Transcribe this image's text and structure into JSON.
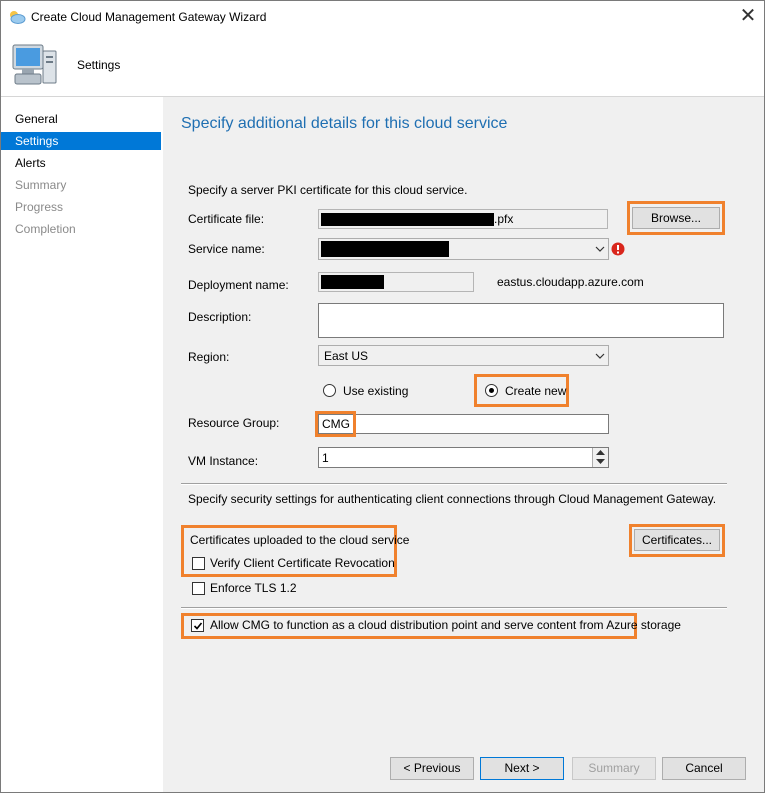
{
  "window": {
    "title": "Create Cloud Management Gateway Wizard",
    "close_glyph": "✕"
  },
  "header": {
    "title": "Settings"
  },
  "nav": [
    {
      "label": "General",
      "state": "normal"
    },
    {
      "label": "Settings",
      "state": "selected"
    },
    {
      "label": "Alerts",
      "state": "normal"
    },
    {
      "label": "Summary",
      "state": "disabled"
    },
    {
      "label": "Progress",
      "state": "disabled"
    },
    {
      "label": "Completion",
      "state": "disabled"
    }
  ],
  "page": {
    "heading": "Specify additional details for this cloud service",
    "pki_intro": "Specify a server PKI certificate for this cloud service.",
    "certificate_file": {
      "label": "Certificate file:",
      "value_suffix": ".pfx",
      "browse_label": "Browse..."
    },
    "service_name": {
      "label": "Service name:"
    },
    "deployment_name": {
      "label": "Deployment name:",
      "domain_suffix": "eastus.cloudapp.azure.com"
    },
    "description": {
      "label": "Description:",
      "value": ""
    },
    "region": {
      "label": "Region:",
      "value": "East US"
    },
    "resource_group_mode": {
      "use_existing": "Use existing",
      "create_new": "Create new",
      "selected": "create_new"
    },
    "resource_group": {
      "label": "Resource Group:",
      "value": "CMG"
    },
    "vm_instance": {
      "label": "VM Instance:",
      "value": "1"
    },
    "security_intro": "Specify security settings for authenticating client connections through Cloud Management Gateway.",
    "certs_uploaded": "Certificates uploaded to the cloud service",
    "certificates_button": "Certificates...",
    "verify_revocation": {
      "label": "Verify Client Certificate Revocation",
      "checked": false
    },
    "enforce_tls": {
      "label": "Enforce TLS 1.2",
      "checked": false
    },
    "allow_cdp": {
      "label": "Allow CMG to function as a cloud distribution point and serve content from Azure storage",
      "checked": true
    }
  },
  "footer": {
    "previous": "< Previous",
    "next": "Next >",
    "summary": "Summary",
    "cancel": "Cancel"
  },
  "colors": {
    "accent": "#0078d7",
    "highlight": "#f0812d",
    "heading": "#1f6fb2",
    "error": "#d9261c"
  }
}
